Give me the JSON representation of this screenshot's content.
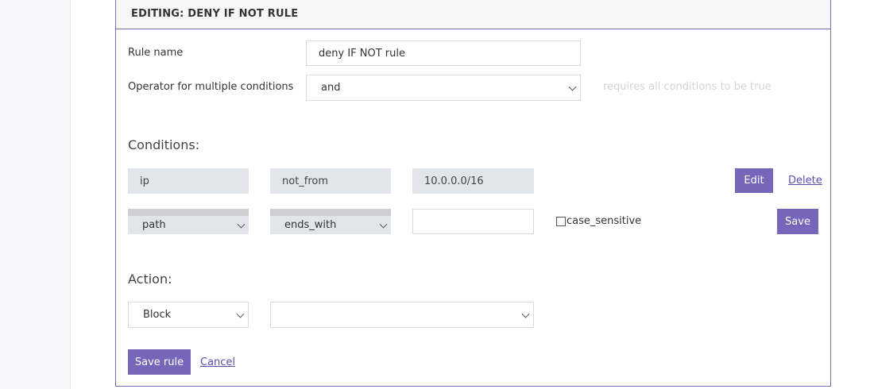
{
  "panel": {
    "title": "EDITING: DENY IF NOT RULE"
  },
  "form": {
    "rule_name_label": "Rule name",
    "rule_name_value": "deny IF NOT rule",
    "operator_label": "Operator for multiple conditions",
    "operator_value": "and",
    "operator_hint": "requires all conditions to be true"
  },
  "conditions": {
    "heading": "Conditions:",
    "existing": {
      "field": "ip",
      "operator": "not_from",
      "value": "10.0.0.0/16",
      "edit_label": "Edit",
      "delete_label": "Delete"
    },
    "new": {
      "field": "path",
      "operator": "ends_with",
      "value": "",
      "checkbox_label": "case_sensitive",
      "save_label": "Save"
    }
  },
  "action": {
    "heading": "Action:",
    "type_value": "Block",
    "param_value": ""
  },
  "footer": {
    "save_rule_label": "Save rule",
    "cancel_label": "Cancel"
  }
}
